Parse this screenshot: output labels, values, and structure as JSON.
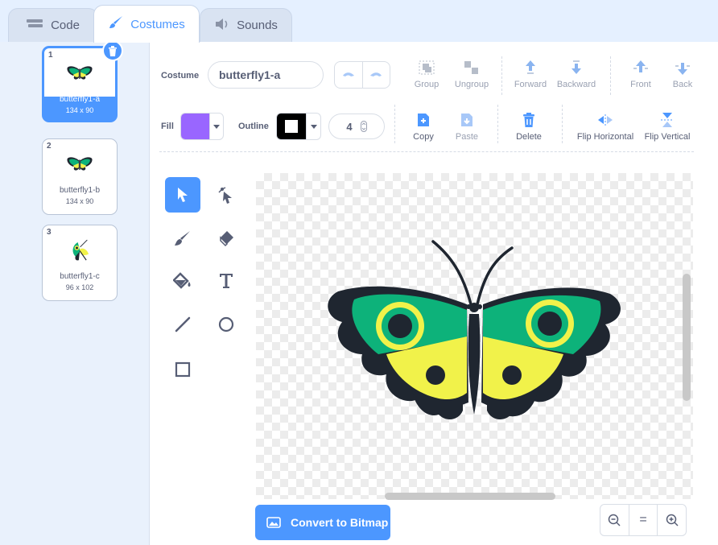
{
  "tabs": [
    {
      "label": "Code",
      "icon": "code-icon"
    },
    {
      "label": "Costumes",
      "icon": "paintbrush-icon"
    },
    {
      "label": "Sounds",
      "icon": "speaker-icon"
    }
  ],
  "costumes": [
    {
      "number": "1",
      "name": "butterfly1-a",
      "size": "134 x 90",
      "selected": true
    },
    {
      "number": "2",
      "name": "butterfly1-b",
      "size": "134 x 90",
      "selected": false
    },
    {
      "number": "3",
      "name": "butterfly1-c",
      "size": "96 x 102",
      "selected": false
    }
  ],
  "toolbar": {
    "costume_label": "Costume",
    "costume_name": "butterfly1-a",
    "group": "Group",
    "ungroup": "Ungroup",
    "forward": "Forward",
    "backward": "Backward",
    "front": "Front",
    "back": "Back",
    "fill_label": "Fill",
    "fill_color": "#9966ff",
    "outline_label": "Outline",
    "outline_color": "#000000",
    "outline_width": "4",
    "copy": "Copy",
    "paste": "Paste",
    "delete": "Delete",
    "flip_horizontal": "Flip Horizontal",
    "flip_vertical": "Flip Vertical"
  },
  "paint_tools": [
    "select",
    "reshape",
    "brush",
    "eraser",
    "fill",
    "text",
    "line",
    "circle",
    "rectangle"
  ],
  "active_tool": "select",
  "bottom": {
    "convert_label": "Convert to Bitmap",
    "zoom_reset": "="
  },
  "colors": {
    "accent": "#4c97ff",
    "butterfly_green": "#0db27a",
    "butterfly_yellow": "#f1f24a",
    "butterfly_dark": "#1f2630"
  }
}
